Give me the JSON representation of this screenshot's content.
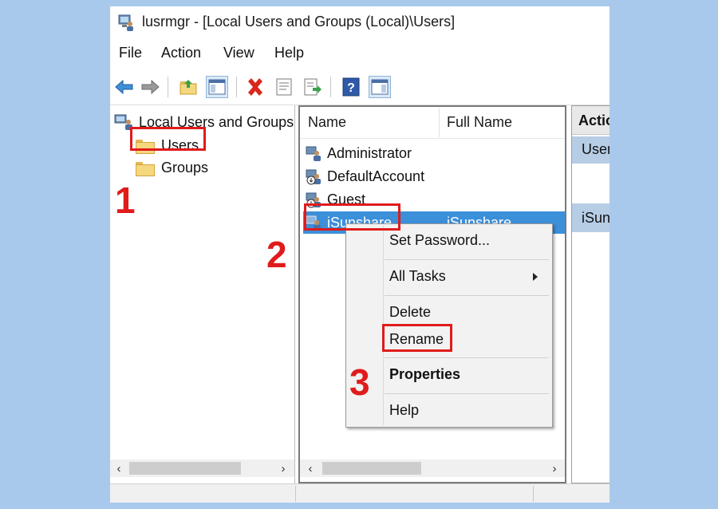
{
  "window": {
    "title": "lusrmgr - [Local Users and Groups (Local)\\Users]",
    "app_icon": "computer-users-icon"
  },
  "menu": [
    "File",
    "Action",
    "View",
    "Help"
  ],
  "toolbar": {
    "icons": [
      "back-arrow-icon",
      "forward-arrow-icon",
      "up-folder-icon",
      "show-hide-console-tree-icon",
      "delete-icon",
      "properties-icon",
      "export-list-icon",
      "help-icon",
      "show-hide-action-pane-icon"
    ]
  },
  "tree": {
    "root": "Local Users and Groups",
    "children": [
      "Users",
      "Groups"
    ]
  },
  "list": {
    "columns": [
      "Name",
      "Full Name"
    ],
    "rows": [
      {
        "name": "Administrator",
        "full_name": "",
        "selected": false
      },
      {
        "name": "DefaultAccount",
        "full_name": "",
        "selected": false
      },
      {
        "name": "Guest",
        "full_name": "",
        "selected": false
      },
      {
        "name": "iSunshare",
        "full_name": "iSunshare",
        "selected": true
      }
    ]
  },
  "actions": {
    "header": "Actio",
    "items": [
      "User",
      "iSun"
    ]
  },
  "context_menu": {
    "items": [
      "Set Password...",
      "All Tasks",
      "Delete",
      "Rename",
      "Properties",
      "Help"
    ]
  },
  "annotations": {
    "step1": "1",
    "step2": "2",
    "step3": "3",
    "color": "#e01b1b"
  },
  "colors": {
    "selection": "#3c8fd9",
    "background": "#a9c9ec"
  }
}
